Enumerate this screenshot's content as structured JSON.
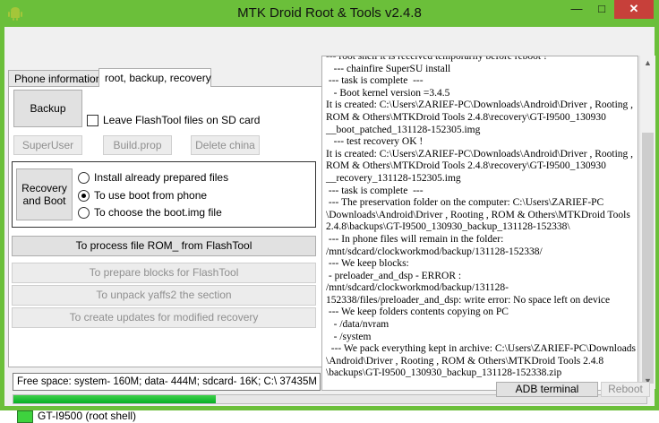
{
  "window": {
    "title": "MTK Droid Root & Tools v2.4.8",
    "accent": "#6bbf3a"
  },
  "titlebar_buttons": {
    "minimize": "—",
    "maximize": "□",
    "close": "✕"
  },
  "tabs": [
    {
      "label": "Phone information",
      "active": false
    },
    {
      "label": "root, backup, recovery",
      "active": true
    }
  ],
  "panel": {
    "backup_label": "Backup",
    "leave_flashtool_label": "Leave FlashTool files on SD card",
    "superuser_label": "SuperUser",
    "buildprop_label": "Build.prop",
    "delete_china_label": "Delete china",
    "recovery_label_line1": "Recovery",
    "recovery_label_line2": "and Boot",
    "radio_options": [
      {
        "label": "Install already prepared files",
        "selected": false
      },
      {
        "label": "To use boot from phone",
        "selected": true
      },
      {
        "label": "To choose the boot.img file",
        "selected": false
      }
    ],
    "process_rom_label": "To process file ROM_ from FlashTool",
    "prepare_blocks_label": "To prepare blocks for FlashTool",
    "unpack_yaffs_label": "To unpack yaffs2 the section",
    "create_updates_label": "To create updates for modified recovery"
  },
  "log": [
    "--- root shell it is received temporarily before reboot !",
    "   --- chainfire SuperSU install",
    " --- task is complete  ---",
    "   - Boot kernel version =3.4.5",
    "It is created: C:\\Users\\ZARIEF-PC\\Downloads\\Android\\Driver , Rooting ,",
    "ROM & Others\\MTKDroid Tools 2.4.8\\recovery\\GT-I9500_130930",
    "__boot_patched_131128-152305.img",
    "   --- test recovery OK !",
    "It is created: C:\\Users\\ZARIEF-PC\\Downloads\\Android\\Driver , Rooting ,",
    "ROM & Others\\MTKDroid Tools 2.4.8\\recovery\\GT-I9500_130930",
    "__recovery_131128-152305.img",
    " --- task is complete  ---",
    " --- The preservation folder on the computer: C:\\Users\\ZARIEF-PC",
    "\\Downloads\\Android\\Driver , Rooting , ROM & Others\\MTKDroid Tools",
    "2.4.8\\backups\\GT-I9500_130930_backup_131128-152338\\",
    " --- In phone files will remain in the folder:",
    "/mnt/sdcard/clockworkmod/backup/131128-152338/",
    " --- We keep blocks:",
    " - preloader_and_dsp - ERROR :",
    "/mnt/sdcard/clockworkmod/backup/131128-",
    "152338/files/preloader_and_dsp: write error: No space left on device",
    " --- We keep folders contents copying on PC",
    "   - /data/nvram",
    "   - /system",
    "  --- We pack everything kept in archive: C:\\Users\\ZARIEF-PC\\Downloads",
    "\\Android\\Driver , Rooting , ROM & Others\\MTKDroid Tools 2.4.8",
    "\\backups\\GT-I9500_130930_backup_131128-152338.zip"
  ],
  "status": {
    "free_space": "Free space: system- 160M; data- 444M; sdcard- 16K;  C:\\ 37435M",
    "progress_fraction": 0.32,
    "device": "GT-I9500 (root shell)",
    "device_color": "#3ed23e",
    "adb_terminal_label": "ADB terminal",
    "reboot_label": "Reboot"
  },
  "icons": {
    "app": "android-icon",
    "scroll_up": "▲",
    "scroll_down": "▼"
  }
}
